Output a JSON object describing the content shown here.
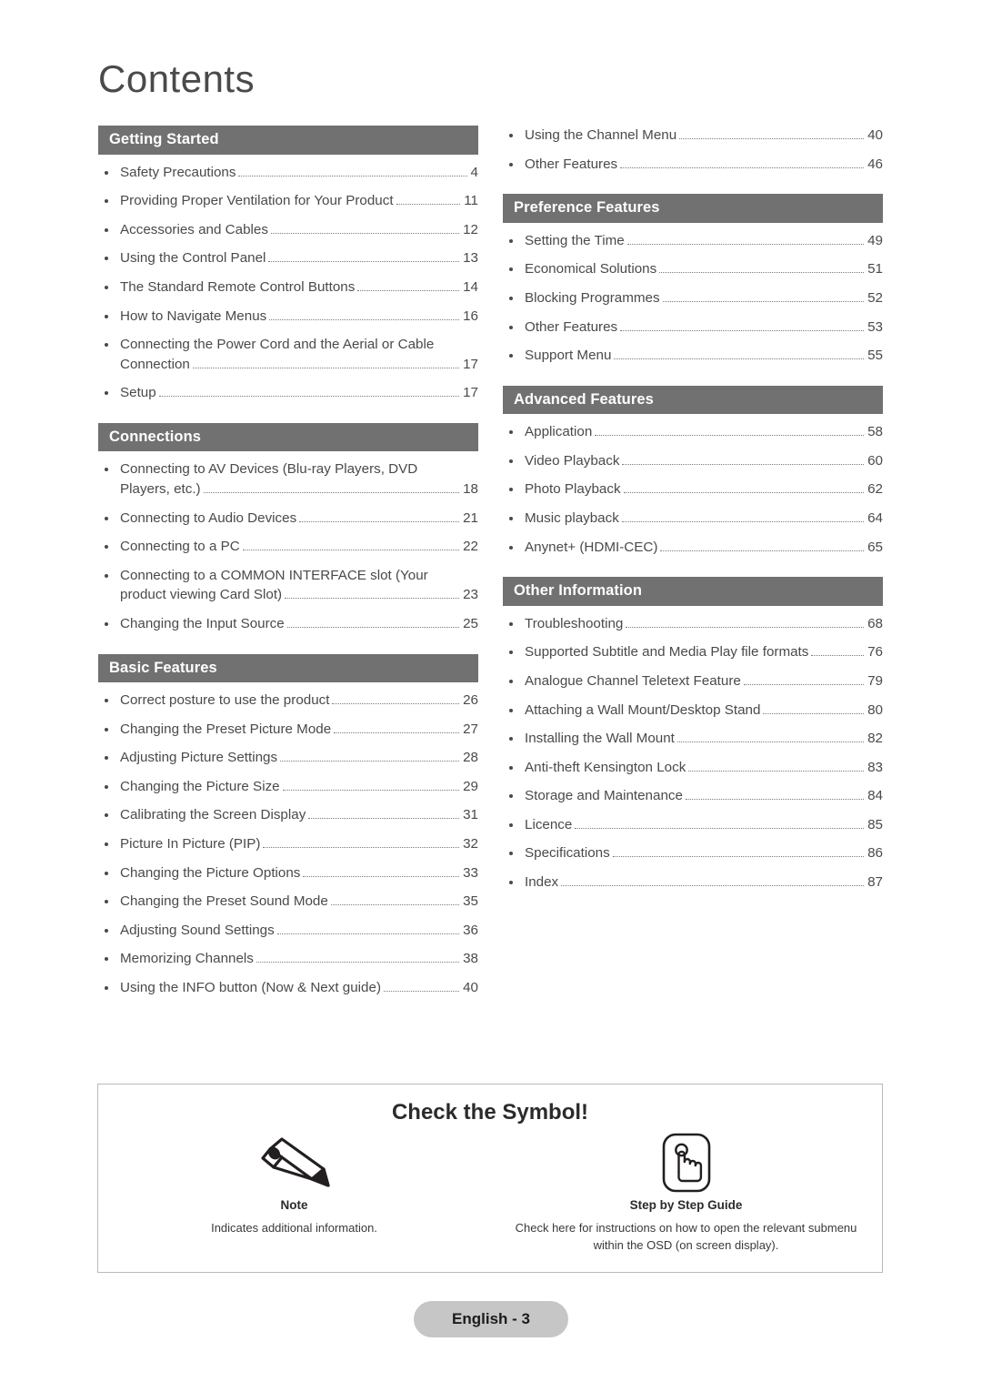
{
  "page": {
    "title": "Contents",
    "footer_label": "English - 3"
  },
  "columns": {
    "left": [
      {
        "heading": "Getting Started",
        "entries": [
          {
            "title": "Safety Precautions",
            "page": "4"
          },
          {
            "title": "Providing Proper Ventilation for Your Product",
            "page": "11"
          },
          {
            "title": "Accessories and Cables",
            "page": "12"
          },
          {
            "title": "Using the Control Panel",
            "page": "13"
          },
          {
            "title": "The Standard Remote Control Buttons",
            "page": "14"
          },
          {
            "title": "How to Navigate Menus",
            "page": "16"
          },
          {
            "title": "Connecting the Power Cord and the Aerial or Cable",
            "title_cont": "Connection",
            "page": "17"
          },
          {
            "title": "Setup",
            "page": "17"
          }
        ]
      },
      {
        "heading": "Connections",
        "entries": [
          {
            "title": "Connecting to AV Devices (Blu-ray Players, DVD",
            "title_cont": "Players, etc.)",
            "page": "18"
          },
          {
            "title": "Connecting to Audio Devices",
            "page": "21"
          },
          {
            "title": "Connecting to a PC",
            "page": "22"
          },
          {
            "title": "Connecting to a COMMON INTERFACE slot (Your",
            "title_cont": "product viewing Card Slot)",
            "page": "23"
          },
          {
            "title": "Changing the Input Source",
            "page": "25"
          }
        ]
      },
      {
        "heading": "Basic Features",
        "entries": [
          {
            "title": "Correct posture to use the product",
            "page": "26"
          },
          {
            "title": "Changing the Preset Picture Mode",
            "page": "27"
          },
          {
            "title": "Adjusting Picture Settings",
            "page": "28"
          },
          {
            "title": "Changing the Picture Size",
            "page": "29"
          },
          {
            "title": "Calibrating the Screen Display",
            "page": "31"
          },
          {
            "title": "Picture In Picture (PIP)",
            "page": "32"
          },
          {
            "title": "Changing the Picture Options",
            "page": "33"
          },
          {
            "title": "Changing the Preset Sound Mode",
            "page": "35"
          },
          {
            "title": "Adjusting Sound Settings",
            "page": "36"
          },
          {
            "title": "Memorizing Channels",
            "page": "38"
          },
          {
            "title": "Using the INFO button (Now & Next guide)",
            "page": "40"
          }
        ]
      }
    ],
    "right": [
      {
        "heading": "",
        "entries": [
          {
            "title": "Using the Channel Menu",
            "page": "40"
          },
          {
            "title": "Other Features",
            "page": "46"
          }
        ]
      },
      {
        "heading": "Preference Features",
        "entries": [
          {
            "title": "Setting the Time",
            "page": "49"
          },
          {
            "title": "Economical Solutions",
            "page": "51"
          },
          {
            "title": "Blocking Programmes",
            "page": "52"
          },
          {
            "title": "Other Features",
            "page": "53"
          },
          {
            "title": "Support Menu",
            "page": "55"
          }
        ]
      },
      {
        "heading": "Advanced Features",
        "entries": [
          {
            "title": "Application",
            "page": "58"
          },
          {
            "title": "Video Playback",
            "page": "60"
          },
          {
            "title": "Photo Playback",
            "page": "62"
          },
          {
            "title": "Music playback",
            "page": "64"
          },
          {
            "title": "Anynet+ (HDMI-CEC)",
            "page": "65"
          }
        ]
      },
      {
        "heading": "Other Information",
        "entries": [
          {
            "title": "Troubleshooting",
            "page": "68"
          },
          {
            "title": "Supported Subtitle and Media Play file formats",
            "page": "76"
          },
          {
            "title": "Analogue Channel Teletext Feature",
            "page": "79"
          },
          {
            "title": "Attaching a Wall Mount/Desktop Stand",
            "page": "80"
          },
          {
            "title": "Installing the Wall Mount",
            "page": "82"
          },
          {
            "title": "Anti-theft Kensington Lock",
            "page": "83"
          },
          {
            "title": "Storage and Maintenance",
            "page": "84"
          },
          {
            "title": "Licence",
            "page": "85"
          },
          {
            "title": "Specifications",
            "page": "86"
          },
          {
            "title": "Index",
            "page": "87"
          }
        ]
      }
    ]
  },
  "symbol_box": {
    "title": "Check the Symbol!",
    "items": [
      {
        "icon": "pencil-icon",
        "label": "Note",
        "description": "Indicates additional information."
      },
      {
        "icon": "step-by-step-guide-icon",
        "label": "Step by Step Guide",
        "description": "Check here for instructions on how to open the relevant submenu within the OSD (on screen display)."
      }
    ]
  },
  "colors": {
    "section_bar": "#717171",
    "footer_badge": "#c6c6c6",
    "text": "#4a4a4a"
  }
}
